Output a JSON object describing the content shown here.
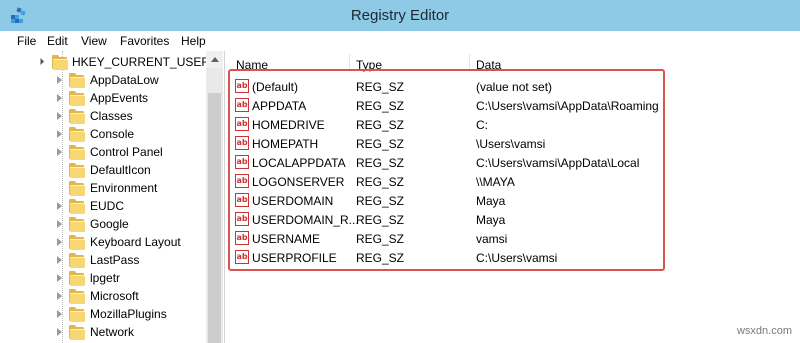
{
  "window": {
    "title": "Registry Editor"
  },
  "menu": [
    "File",
    "Edit",
    "View",
    "Favorites",
    "Help"
  ],
  "tree": {
    "root": "HKEY_CURRENT_USER",
    "items": [
      {
        "label": "AppDataLow",
        "expandable": true
      },
      {
        "label": "AppEvents",
        "expandable": true
      },
      {
        "label": "Classes",
        "expandable": true
      },
      {
        "label": "Console",
        "expandable": true
      },
      {
        "label": "Control Panel",
        "expandable": true
      },
      {
        "label": "DefaultIcon",
        "expandable": false
      },
      {
        "label": "Environment",
        "expandable": false
      },
      {
        "label": "EUDC",
        "expandable": true
      },
      {
        "label": "Google",
        "expandable": true
      },
      {
        "label": "Keyboard Layout",
        "expandable": true
      },
      {
        "label": "LastPass",
        "expandable": true
      },
      {
        "label": "lpgetr",
        "expandable": true
      },
      {
        "label": "Microsoft",
        "expandable": true
      },
      {
        "label": "MozillaPlugins",
        "expandable": true
      },
      {
        "label": "Network",
        "expandable": true
      }
    ]
  },
  "list": {
    "columns": [
      "Name",
      "Type",
      "Data"
    ],
    "rows": [
      {
        "name": "(Default)",
        "type": "REG_SZ",
        "data": "(value not set)"
      },
      {
        "name": "APPDATA",
        "type": "REG_SZ",
        "data": "C:\\Users\\vamsi\\AppData\\Roaming"
      },
      {
        "name": "HOMEDRIVE",
        "type": "REG_SZ",
        "data": "C:"
      },
      {
        "name": "HOMEPATH",
        "type": "REG_SZ",
        "data": "\\Users\\vamsi"
      },
      {
        "name": "LOCALAPPDATA",
        "type": "REG_SZ",
        "data": "C:\\Users\\vamsi\\AppData\\Local"
      },
      {
        "name": "LOGONSERVER",
        "type": "REG_SZ",
        "data": "\\\\MAYA"
      },
      {
        "name": "USERDOMAIN",
        "type": "REG_SZ",
        "data": "Maya"
      },
      {
        "name": "USERDOMAIN_R...",
        "type": "REG_SZ",
        "data": "Maya"
      },
      {
        "name": "USERNAME",
        "type": "REG_SZ",
        "data": "vamsi"
      },
      {
        "name": "USERPROFILE",
        "type": "REG_SZ",
        "data": "C:\\Users\\vamsi"
      }
    ],
    "value_icon_text": "ab"
  },
  "watermark": "wsxdn.com",
  "colors": {
    "titlebar": "#8ec9e6",
    "highlight": "#d9534f",
    "folder": "#f6d774"
  }
}
